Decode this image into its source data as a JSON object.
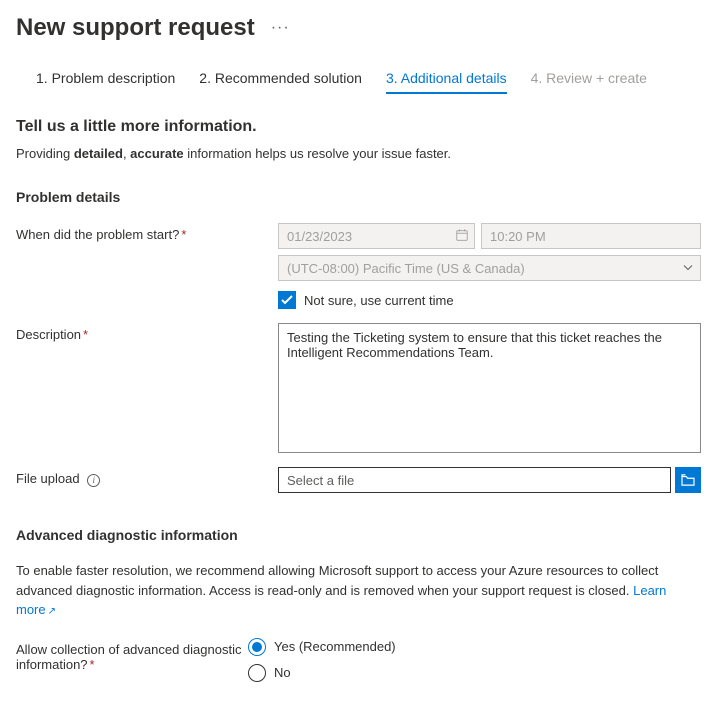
{
  "header": {
    "title": "New support request"
  },
  "tabs": [
    {
      "label": "1. Problem description"
    },
    {
      "label": "2. Recommended solution"
    },
    {
      "label": "3. Additional details"
    },
    {
      "label": "4. Review + create"
    }
  ],
  "intro": {
    "title": "Tell us a little more information.",
    "text_pre": "Providing ",
    "bold1": "detailed",
    "sep": ", ",
    "bold2": "accurate",
    "text_post": " information helps us resolve your issue faster."
  },
  "problem": {
    "section_title": "Problem details",
    "when_label": "When did the problem start?",
    "date_value": "01/23/2023",
    "time_value": "10:20 PM",
    "timezone_value": "(UTC-08:00) Pacific Time (US & Canada)",
    "checkbox_label": "Not sure, use current time",
    "desc_label": "Description",
    "desc_value": "Testing the Ticketing system to ensure that this ticket reaches the Intelligent Recommendations Team.",
    "upload_label": "File upload",
    "upload_placeholder": "Select a file"
  },
  "advanced": {
    "section_title": "Advanced diagnostic information",
    "desc": "To enable faster resolution, we recommend allowing Microsoft support to access your Azure resources to collect advanced diagnostic information. Access is read-only and is removed when your support request is closed. ",
    "learn_more": "Learn more",
    "allow_label": "Allow collection of advanced diagnostic information?",
    "opt_yes": "Yes (Recommended)",
    "opt_no": "No"
  }
}
